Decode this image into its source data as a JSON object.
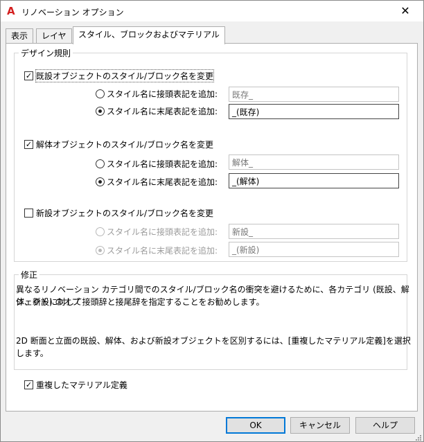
{
  "window": {
    "title": "リノベーション オプション",
    "app_icon": "A",
    "close_glyph": "✕"
  },
  "tabs": [
    {
      "label": "表示"
    },
    {
      "label": "レイヤ"
    },
    {
      "label": "スタイル、ブロックおよびマテリアル"
    }
  ],
  "design_rules": {
    "title": "デザイン規則",
    "groups": [
      {
        "checkbox_label": "既設オブジェクトのスタイル/ブロック名を変更",
        "checked": true,
        "prefix_label": "スタイル名に接頭表記を追加:",
        "prefix_value": "既存_",
        "suffix_label": "スタイル名に末尾表記を追加:",
        "suffix_value": "_(既存)",
        "selected": "suffix"
      },
      {
        "checkbox_label": "解体オブジェクトのスタイル/ブロック名を変更",
        "checked": true,
        "prefix_label": "スタイル名に接頭表記を追加:",
        "prefix_value": "解体_",
        "suffix_label": "スタイル名に末尾表記を追加:",
        "suffix_value": "_(解体)",
        "selected": "suffix"
      },
      {
        "checkbox_label": "新設オブジェクトのスタイル/ブロック名を変更",
        "checked": false,
        "prefix_label": "スタイル名に接頭表記を追加:",
        "prefix_value": "新設_",
        "suffix_label": "スタイル名に末尾表記を追加:",
        "suffix_value": "_(新設)",
        "selected": "suffix"
      }
    ]
  },
  "correction": {
    "title": "修正",
    "line1": "異なるリノベーション カテゴリ間でのスタイル/ブロック名の衝突を避けるために、各カテゴリ (既設、解体、新設) のオブ",
    "line2": "ジェクトに対して接頭辞と接尾辞を指定することをお勧めします。",
    "line3": "2D 断面と立面の既設、解体、および新設オブジェクトを区別するには、[重複したマテリアル定義]を選択します。"
  },
  "overlap": {
    "label": "重複したマテリアル定義",
    "checked": true
  },
  "buttons": {
    "ok": "OK",
    "cancel": "キャンセル",
    "help": "ヘルプ"
  },
  "colors": {
    "focus_border": "#0078d7",
    "app_icon": "#d42020"
  }
}
